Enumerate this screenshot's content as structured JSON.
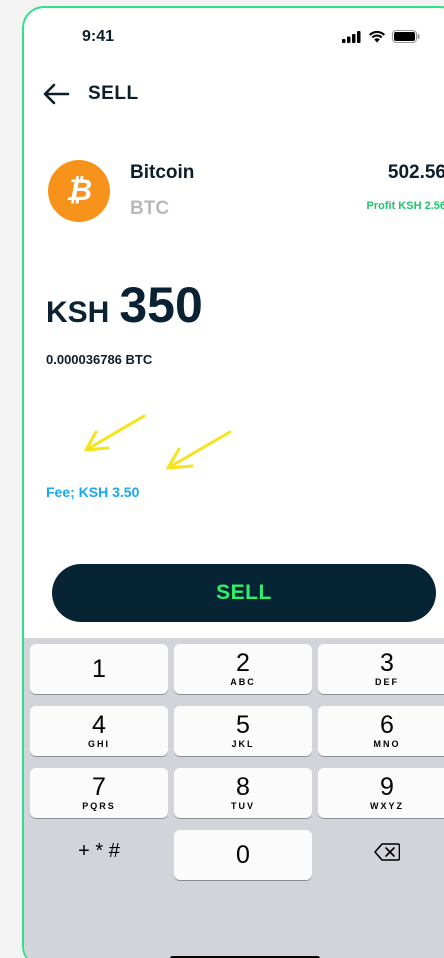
{
  "status_bar": {
    "time": "9:41"
  },
  "header": {
    "title": "SELL"
  },
  "coin": {
    "name": "Bitcoin",
    "symbol": "BTC",
    "logo_glyph": "₿",
    "price": "502.56",
    "profit": "Profit KSH 2.56",
    "colors": {
      "logo": "#f7931a",
      "profit": "#22c46f"
    }
  },
  "amount": {
    "currency": "KSH",
    "value": "350",
    "crypto_equivalent": "0.000036786 BTC"
  },
  "fee": {
    "label": "Fee; KSH 3.50",
    "color": "#17a8f5"
  },
  "sell_button": {
    "label": "SELL",
    "bg": "#062433",
    "fg": "#2ef06f"
  },
  "keypad": {
    "keys": [
      {
        "digit": "1",
        "letters": ""
      },
      {
        "digit": "2",
        "letters": "ABC"
      },
      {
        "digit": "3",
        "letters": "DEF"
      },
      {
        "digit": "4",
        "letters": "GHI"
      },
      {
        "digit": "5",
        "letters": "JKL"
      },
      {
        "digit": "6",
        "letters": "MNO"
      },
      {
        "digit": "7",
        "letters": "PQRS"
      },
      {
        "digit": "8",
        "letters": "TUV"
      },
      {
        "digit": "9",
        "letters": "WXYZ"
      },
      {
        "digit": "+ * #",
        "letters": ""
      },
      {
        "digit": "0",
        "letters": ""
      },
      {
        "digit": "",
        "letters": ""
      }
    ],
    "backspace_icon": "backspace-icon"
  },
  "annotation": {
    "color": "#f5e41a",
    "icon": "arrow-annotation"
  }
}
